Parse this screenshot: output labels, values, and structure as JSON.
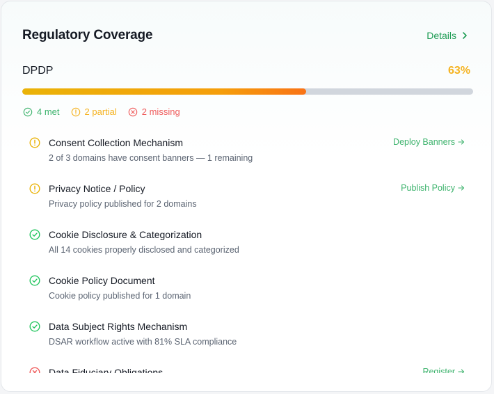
{
  "card": {
    "title": "Regulatory Coverage",
    "details_label": "Details"
  },
  "regulation": {
    "name": "DPDP",
    "percent_label": "63%",
    "progress": 0.63
  },
  "summary": {
    "met": "4 met",
    "partial": "2 partial",
    "missing": "2 missing"
  },
  "colors": {
    "met": "#22c55e",
    "partial": "#f5b321",
    "missing": "#ef5b5b",
    "accent": "#1f9d55"
  },
  "requirements": [
    {
      "status": "partial",
      "icon": "warning-circle-icon",
      "name": "Consent Collection Mechanism",
      "description": "2 of 3 domains have consent banners — 1 remaining",
      "action": "Deploy Banners"
    },
    {
      "status": "partial",
      "icon": "warning-circle-icon",
      "name": "Privacy Notice / Policy",
      "description": "Privacy policy published for 2 domains",
      "action": "Publish Policy"
    },
    {
      "status": "met",
      "icon": "check-circle-icon",
      "name": "Cookie Disclosure & Categorization",
      "description": "All 14 cookies properly disclosed and categorized",
      "action": ""
    },
    {
      "status": "met",
      "icon": "check-circle-icon",
      "name": "Cookie Policy Document",
      "description": "Cookie policy published for 1 domain",
      "action": ""
    },
    {
      "status": "met",
      "icon": "check-circle-icon",
      "name": "Data Subject Rights Mechanism",
      "description": "DSAR workflow active with 81% SLA compliance",
      "action": ""
    },
    {
      "status": "missing",
      "icon": "x-circle-icon",
      "name": "Data Fiduciary Obligations",
      "description": "",
      "action": "Register"
    }
  ]
}
